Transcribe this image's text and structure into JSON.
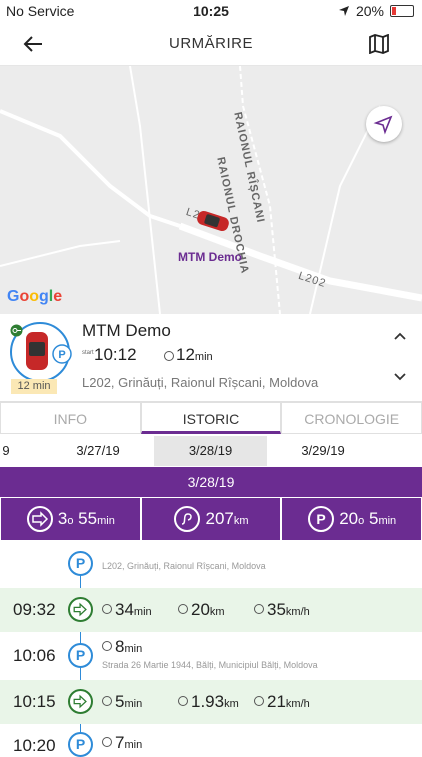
{
  "status": {
    "carrier": "No Service",
    "time": "10:25",
    "battery": "20%"
  },
  "nav": {
    "title": "URMĂRIRE"
  },
  "map": {
    "road_labels": [
      "RAIONUL DROCHIA",
      "RAIONUL RÎȘCANI",
      "L2",
      "L202"
    ],
    "vehicle_label": "MTM Demo",
    "google": [
      "G",
      "o",
      "o",
      "g",
      "l",
      "e"
    ]
  },
  "vehicle": {
    "name": "MTM Demo",
    "start_label": "start",
    "start_time": "10:12",
    "duration_value": "12",
    "duration_unit": "min",
    "parking_duration": "12 min",
    "address": "L202, Grinăuți, Raionul Rîșcani, Moldova"
  },
  "tabs": [
    "INFO",
    "ISTORIC",
    "CRONOLOGIE"
  ],
  "dates": [
    "9",
    "3/27/19",
    "3/28/19",
    "3/29/19"
  ],
  "selected_date": "3/28/19",
  "summary": {
    "drive_h": "3",
    "drive_sep": "o",
    "drive_m": "55",
    "drive_unit": "min",
    "distance": "207",
    "distance_unit": "km",
    "park_h": "20",
    "park_sep": "o",
    "park_m": "5",
    "park_unit": "min"
  },
  "timeline": {
    "first_address": "L202, Grinăuți, Raionul Rîșcani, Moldova",
    "rows": [
      {
        "time": "09:32",
        "dur": "34",
        "dur_unit": "min",
        "dist": "20",
        "dist_unit": "km",
        "speed": "35",
        "speed_unit": "km/h"
      },
      {
        "time": "10:06",
        "dur": "8",
        "dur_unit": "min",
        "address": "Strada 26 Martie 1944, Bălți, Municipiul Bălți, Moldova"
      },
      {
        "time": "10:15",
        "dur": "5",
        "dur_unit": "min",
        "dist": "1.93",
        "dist_unit": "km",
        "speed": "21",
        "speed_unit": "km/h"
      },
      {
        "time": "10:20",
        "dur": "7",
        "dur_unit": "min"
      }
    ]
  },
  "colors": {
    "accent": "#6b2c91",
    "park_blue": "#2e8bd8",
    "trip_green": "#2e7d32",
    "trip_bg": "#e9f5e8"
  }
}
